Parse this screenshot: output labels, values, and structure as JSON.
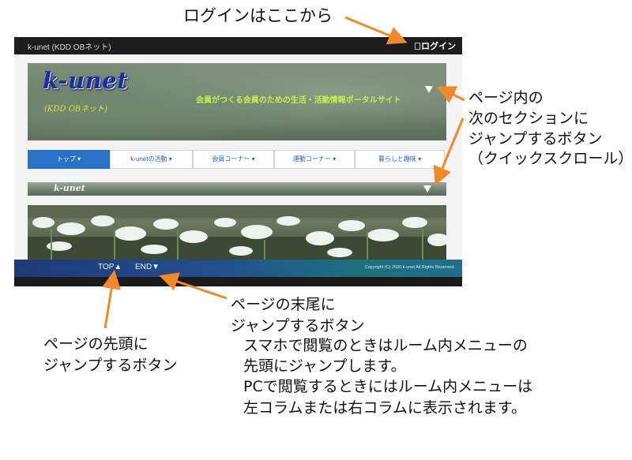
{
  "annotations": {
    "login": "ログインはここから",
    "quick_scroll": [
      "ページ内の",
      "次のセクションに",
      "ジャンプするボタン",
      "（クイックスクロール）"
    ],
    "top_button": [
      "ページの先頭に",
      "ジャンプするボタン"
    ],
    "end_button": [
      "ページの末尾に",
      "ジャンプするボタン"
    ],
    "note": [
      "スマホで閲覧のときはルーム内メニューの",
      "先頭にジャンプします。",
      "PCで閲覧するときにはルーム内メニューは",
      "左コラムまたは右コラムに表示されます。"
    ]
  },
  "site": {
    "title": "k-unet (KDD OBネット)",
    "login_label": "ログイン",
    "logo": "k-unet",
    "logo_sub": "(KDD OBネット)",
    "tagline": "会員がつくる会員のための生活・活動情報ポータルサイト",
    "nav": [
      "トップ ▾",
      "k-unetの活動 ▾",
      "会員コーナー ▾",
      "運動コーナー ▾",
      "暮らしと趣味 ▾"
    ],
    "section_bar": "k-unet",
    "footer_top": "TOP▲",
    "footer_end": "END▼",
    "copyright": "Copyright (C) 2020 k-unet All Rights Reserved."
  },
  "colors": {
    "arrow": "#f0892a",
    "nav_active": "#2a72c8"
  }
}
